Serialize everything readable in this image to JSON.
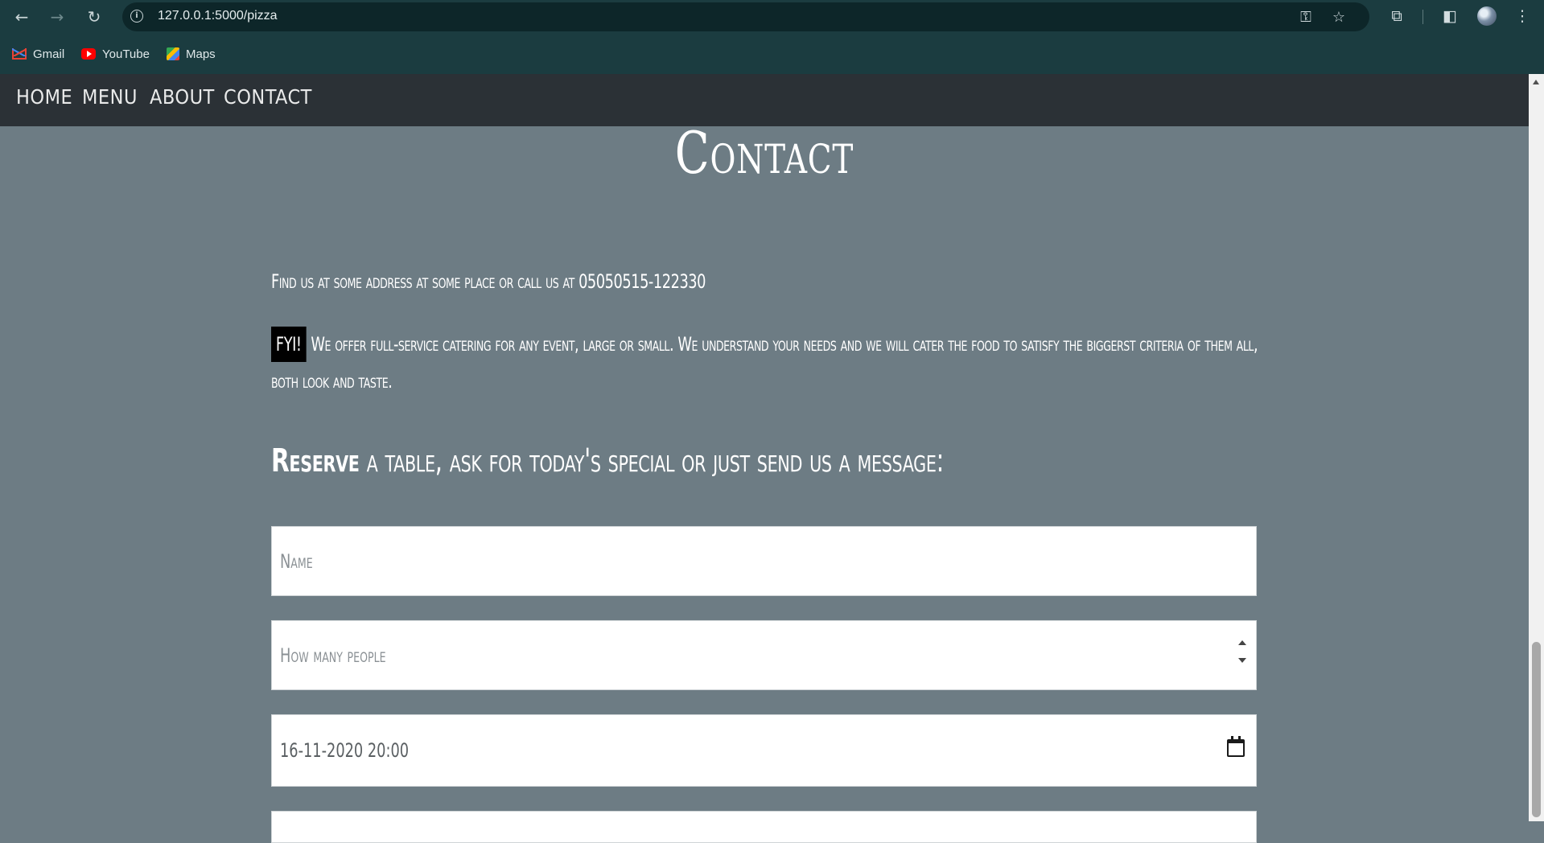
{
  "browser": {
    "url": "127.0.0.1:5000/pizza",
    "bookmarks": [
      {
        "label": "Gmail",
        "icon": "gmail-icon"
      },
      {
        "label": "YouTube",
        "icon": "youtube-icon"
      },
      {
        "label": "Maps",
        "icon": "maps-icon"
      }
    ]
  },
  "nav": {
    "items": [
      "HOME",
      "MENU",
      "ABOUT",
      "CONTACT"
    ]
  },
  "contact": {
    "title": "Contact",
    "address": "Find us at some address at some place or call us at 05050515-122330",
    "fyi_tag": "FYI!",
    "catering": "We offer full-service catering for any event, large or small. We understand your needs and we will cater the food to satisfy the biggerst criteria of them all, both look and taste.",
    "reserve_bold": "Reserve",
    "reserve_rest": "a table, ask for today's special or just send us a message:"
  },
  "form": {
    "name_placeholder": "Name",
    "people_placeholder": "How many people",
    "datetime_value": "16-11-2020 20:00"
  },
  "colors": {
    "page_bg": "#6d7c84",
    "nav_bg": "#2b3136",
    "chrome_bg": "#1b3c40"
  }
}
